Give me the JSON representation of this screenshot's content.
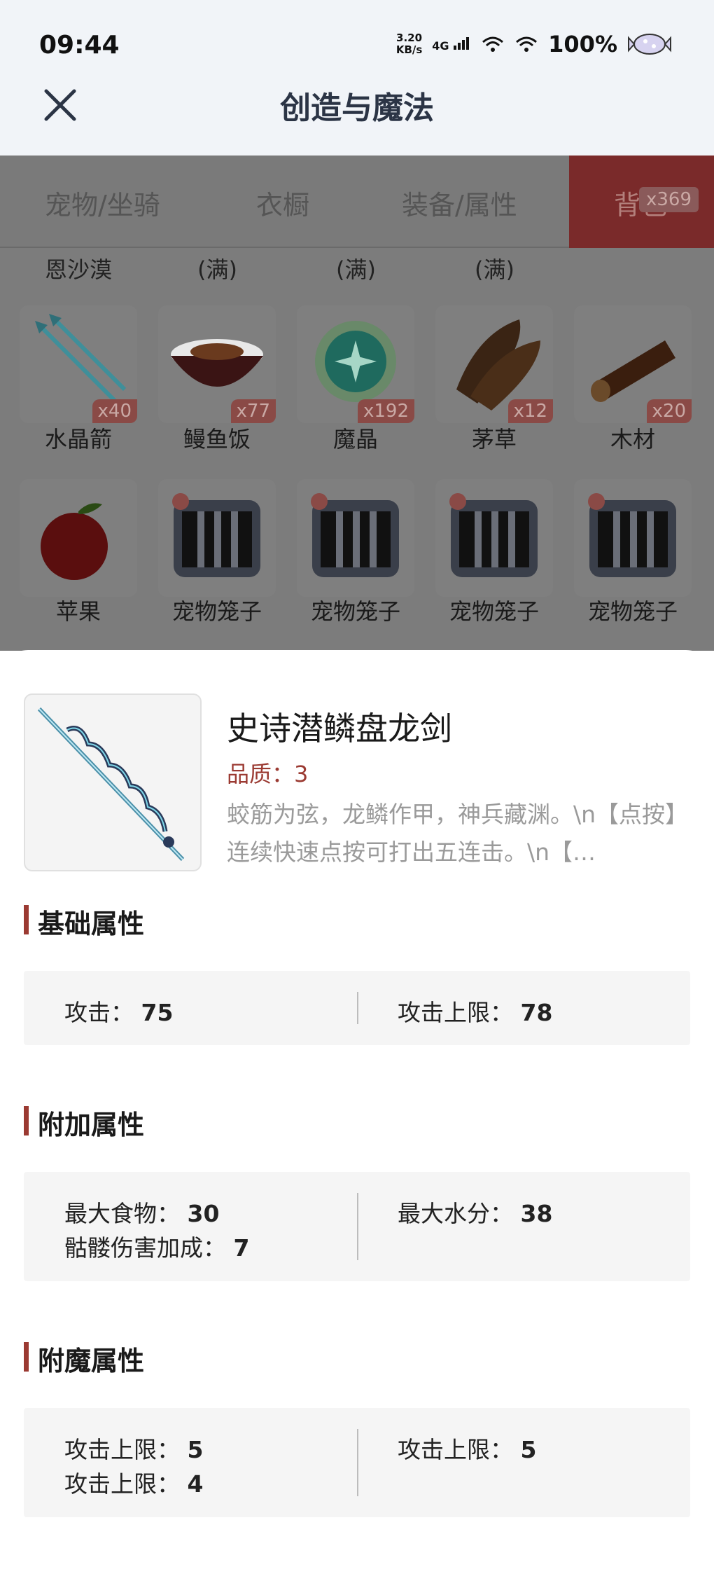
{
  "status": {
    "time": "09:44",
    "speed_top": "3.20",
    "speed_bottom": "KB/s",
    "network": "4G",
    "battery": "100%"
  },
  "header": {
    "title": "创造与魔法"
  },
  "tabs": {
    "items": [
      "宠物/坐骑",
      "衣橱",
      "装备/属性"
    ],
    "active_label": "背包",
    "active_badge": "x369"
  },
  "grid": {
    "row0": [
      "恩沙漠",
      "(满)",
      "(满)",
      "(满)"
    ],
    "row1": [
      {
        "label": "水晶箭",
        "count": "x40",
        "icon": "crystal-arrow-icon"
      },
      {
        "label": "鳗鱼饭",
        "count": "x77",
        "icon": "eel-rice-icon"
      },
      {
        "label": "魔晶",
        "count": "x192",
        "icon": "magic-crystal-icon"
      },
      {
        "label": "茅草",
        "count": "x12",
        "icon": "thatch-icon"
      },
      {
        "label": "木材",
        "count": "x20",
        "icon": "wood-icon"
      }
    ],
    "row2": [
      {
        "label": "苹果",
        "icon": "apple-icon"
      },
      {
        "label": "宠物笼子",
        "icon": "pet-cage-icon"
      },
      {
        "label": "宠物笼子",
        "icon": "pet-cage-icon"
      },
      {
        "label": "宠物笼子",
        "icon": "pet-cage-icon"
      },
      {
        "label": "宠物笼子",
        "icon": "pet-cage-icon"
      }
    ]
  },
  "item": {
    "name": "史诗潜鳞盘龙剑",
    "quality": "品质：3",
    "description": "蛟筋为弦，龙鳞作甲，神兵藏渊。\\n【点按】连续快速点按可打出五连击。\\n【…",
    "icon": "dragon-sword-icon"
  },
  "sections": {
    "base": {
      "title": "基础属性",
      "left": [
        {
          "label": "攻击：",
          "value": "75"
        }
      ],
      "right": [
        {
          "label": "攻击上限：",
          "value": "78"
        }
      ]
    },
    "extra": {
      "title": "附加属性",
      "left": [
        {
          "label": "最大食物：",
          "value": "30"
        },
        {
          "label": "骷髅伤害加成：",
          "value": "7"
        }
      ],
      "right": [
        {
          "label": "最大水分：",
          "value": "38"
        }
      ]
    },
    "enchant": {
      "title": "附魔属性",
      "left": [
        {
          "label": "攻击上限：",
          "value": "5"
        },
        {
          "label": "攻击上限：",
          "value": "4"
        }
      ],
      "right": [
        {
          "label": "攻击上限：",
          "value": "5"
        }
      ]
    }
  },
  "colors": {
    "accent": "#9b3a32",
    "header_bg": "#f1f4f8",
    "overlay": "#7c7c7c"
  }
}
